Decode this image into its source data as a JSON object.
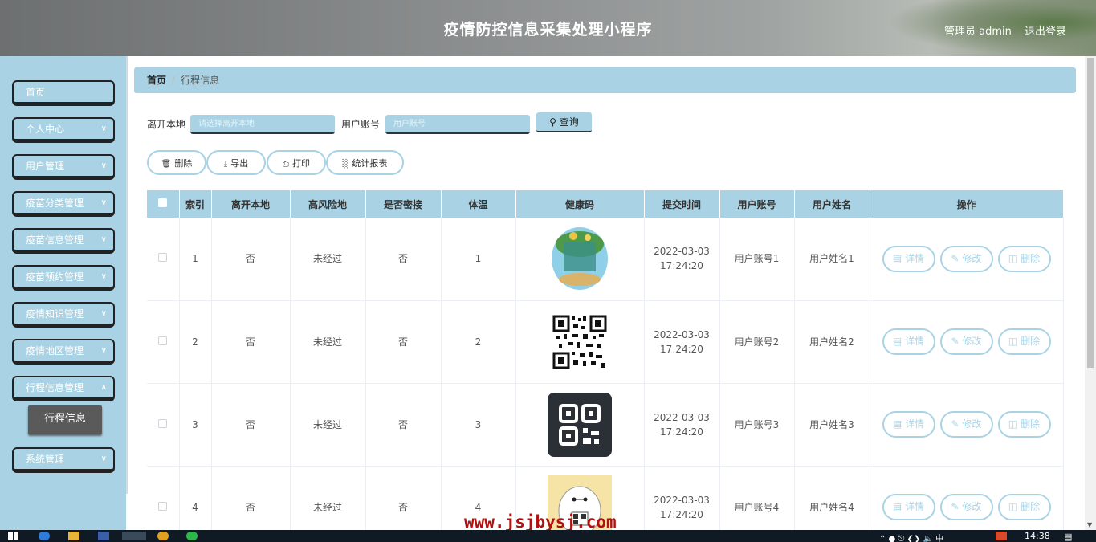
{
  "header": {
    "title": "疫情防控信息采集处理小程序",
    "user": "管理员 admin",
    "logout": "退出登录"
  },
  "sidebar": {
    "items": [
      {
        "label": "首页"
      },
      {
        "label": "个人中心"
      },
      {
        "label": "用户管理"
      },
      {
        "label": "疫苗分类管理"
      },
      {
        "label": "疫苗信息管理"
      },
      {
        "label": "疫苗预约管理"
      },
      {
        "label": "疫情知识管理"
      },
      {
        "label": "疫情地区管理"
      },
      {
        "label": "行程信息管理"
      },
      {
        "label": "系统管理"
      }
    ],
    "active_sub": "行程信息"
  },
  "breadcrumb": {
    "home": "首页",
    "separator": "/",
    "current": "行程信息"
  },
  "search": {
    "leave_label": "离开本地",
    "leave_placeholder": "请选择离开本地",
    "account_label": "用户账号",
    "account_placeholder": "用户账号",
    "query": "查询"
  },
  "actions": {
    "delete": "删除",
    "export": "导出",
    "print": "打印",
    "report": "统计报表"
  },
  "table": {
    "headers": [
      "索引",
      "离开本地",
      "高风险地",
      "是否密接",
      "体温",
      "健康码",
      "提交时间",
      "用户账号",
      "用户姓名",
      "操作"
    ],
    "rows": [
      {
        "index": "1",
        "leave": "否",
        "risk": "未经过",
        "contact": "否",
        "temp": "1",
        "time": "2022-03-03 17:24:20",
        "account": "用户账号1",
        "name": "用户姓名1"
      },
      {
        "index": "2",
        "leave": "否",
        "risk": "未经过",
        "contact": "否",
        "temp": "2",
        "time": "2022-03-03 17:24:20",
        "account": "用户账号2",
        "name": "用户姓名2"
      },
      {
        "index": "3",
        "leave": "否",
        "risk": "未经过",
        "contact": "否",
        "temp": "3",
        "time": "2022-03-03 17:24:20",
        "account": "用户账号3",
        "name": "用户姓名3"
      },
      {
        "index": "4",
        "leave": "否",
        "risk": "未经过",
        "contact": "否",
        "temp": "4",
        "time": "2022-03-03 17:24:20",
        "account": "用户账号4",
        "name": "用户姓名4"
      }
    ],
    "row_actions": {
      "detail": "详情",
      "edit": "修改",
      "delete": "删除"
    }
  },
  "watermark": "www.jsjbysj.com",
  "taskbar": {
    "time": "14:38"
  },
  "colors": {
    "accent": "#a9d3e4",
    "dark": "#333333",
    "watermark": "#b01010"
  }
}
